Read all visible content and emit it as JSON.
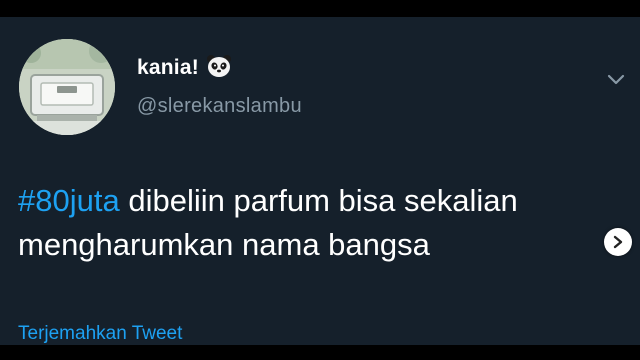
{
  "colors": {
    "background": "#15202b",
    "link_blue": "#1da1f2",
    "secondary_text": "#8899a6",
    "primary_text": "#ffffff"
  },
  "tweet": {
    "author": {
      "display_name": "kania!",
      "name_emoji_icon": "panda-face-icon",
      "handle": "@slerekanslambu",
      "avatar_icon": "profile-photo-avatar"
    },
    "body": {
      "hashtag": "#80juta",
      "text_line1": " dibeliin parfum bisa sekalian",
      "text_line2": "mengharumkan nama bangsa"
    },
    "translate_label": "Terjemahkan Tweet",
    "menu_icon": "chevron-down-icon",
    "next_icon": "chevron-right-icon"
  }
}
